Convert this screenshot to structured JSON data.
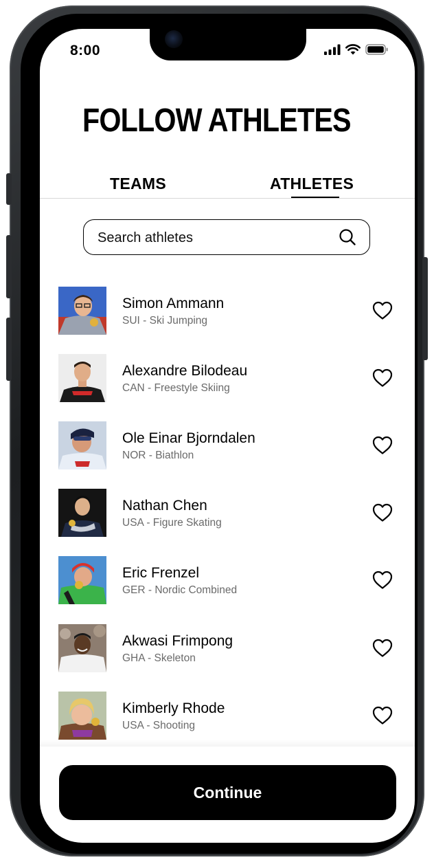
{
  "status_bar": {
    "time": "8:00"
  },
  "title": "FOLLOW ATHLETES",
  "tabs": [
    {
      "label": "TEAMS",
      "active": false
    },
    {
      "label": "ATHLETES",
      "active": true
    }
  ],
  "search": {
    "placeholder": "Search athletes"
  },
  "athletes": [
    {
      "name": "Simon Ammann",
      "detail": "SUI - Ski Jumping",
      "favorited": false
    },
    {
      "name": "Alexandre Bilodeau",
      "detail": "CAN - Freestyle Skiing",
      "favorited": false
    },
    {
      "name": "Ole Einar Bjorndalen",
      "detail": "NOR - Biathlon",
      "favorited": false
    },
    {
      "name": "Nathan Chen",
      "detail": "USA - Figure Skating",
      "favorited": false
    },
    {
      "name": "Eric Frenzel",
      "detail": "GER - Nordic Combined",
      "favorited": false
    },
    {
      "name": "Akwasi Frimpong",
      "detail": "GHA - Skeleton",
      "favorited": false
    },
    {
      "name": "Kimberly Rhode",
      "detail": "USA - Shooting",
      "favorited": false
    }
  ],
  "continue_button": {
    "label": "Continue"
  },
  "icons": {
    "search": "search-icon",
    "favorite": "heart-outline-icon",
    "signal": "cellular-signal-icon",
    "wifi": "wifi-icon",
    "battery": "battery-icon"
  },
  "colors": {
    "primary": "#000000",
    "background": "#ffffff",
    "secondary_text": "#6a6a6a",
    "divider": "#d8d8d8"
  }
}
